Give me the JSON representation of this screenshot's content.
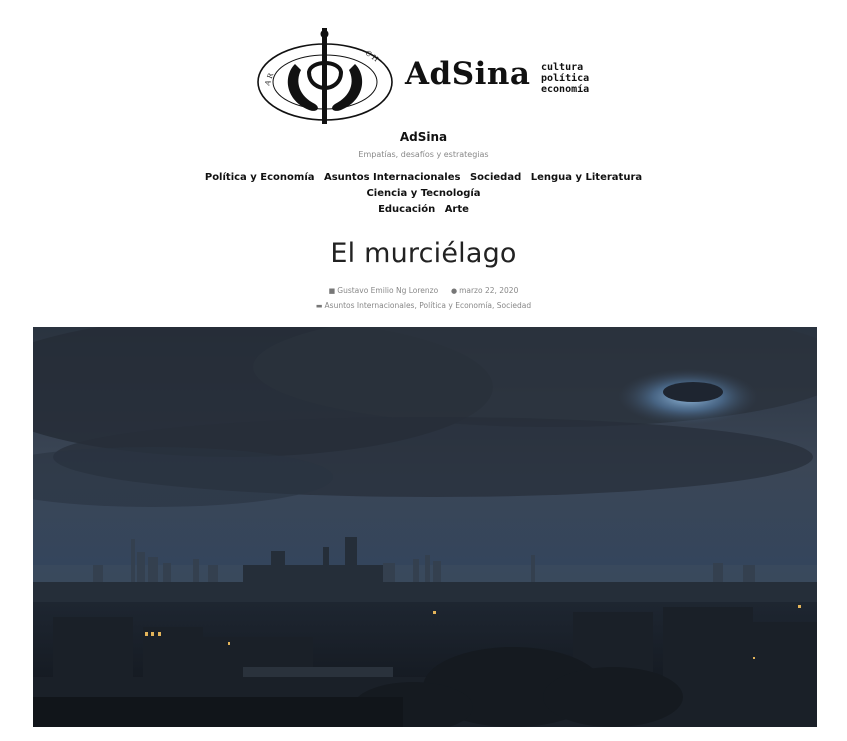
{
  "logo": {
    "wordmark": "AdSina",
    "tagline": [
      "cultura",
      "política",
      "economía"
    ],
    "seal_text": "CHINA ARGENTINA"
  },
  "site": {
    "title": "AdSina",
    "description": "Empatías, desafíos y estrategias"
  },
  "nav": {
    "items": [
      "Política y Economía",
      "Asuntos Internacionales",
      "Sociedad",
      "Lengua y Literatura",
      "Ciencia y Tecnología",
      "Educación",
      "Arte"
    ]
  },
  "post": {
    "title": "El murciélago",
    "author": "Gustavo Emilio Ng Lorenzo",
    "date": "marzo 22, 2020",
    "categories": [
      "Asuntos Internacionales",
      "Política y Economía",
      "Sociedad"
    ],
    "category_separator": ", "
  },
  "icons": {
    "author": "person-icon",
    "date": "clock-icon",
    "categories": "folder-icon"
  },
  "colors": {
    "text": "#111111",
    "muted": "#888888",
    "background": "#ffffff"
  }
}
